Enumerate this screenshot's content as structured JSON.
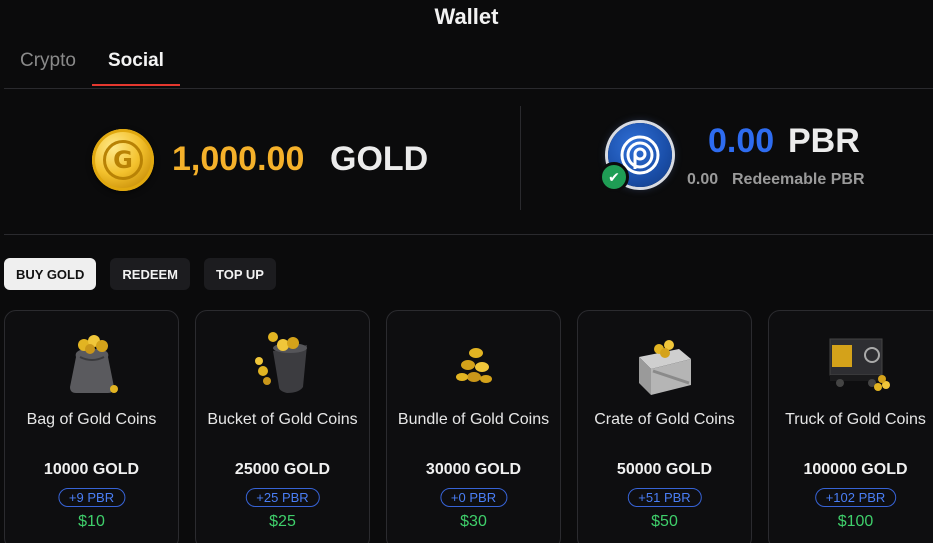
{
  "page": {
    "title": "Wallet"
  },
  "tabs": [
    {
      "label": "Crypto",
      "active": false
    },
    {
      "label": "Social",
      "active": true
    }
  ],
  "balances": {
    "gold": {
      "amount": "1,000.00",
      "unit": "GOLD",
      "icon": "gold-coin-icon"
    },
    "pbr": {
      "amount": "0.00",
      "unit": "PBR",
      "redeemable_value": "0.00",
      "redeemable_label": "Redeemable PBR",
      "icon": "pbr-coin-icon",
      "verified_icon": "check-icon"
    }
  },
  "actions": [
    {
      "label": "BUY GOLD",
      "active": true
    },
    {
      "label": "REDEEM",
      "active": false
    },
    {
      "label": "TOP UP",
      "active": false
    }
  ],
  "packages": [
    {
      "name": "Bag of Gold Coins",
      "amount": "10000 GOLD",
      "pbr_bonus": "+9 PBR",
      "price": "$10",
      "icon": "gold-bag-icon"
    },
    {
      "name": "Bucket of Gold Coins",
      "amount": "25000 GOLD",
      "pbr_bonus": "+25 PBR",
      "price": "$25",
      "icon": "gold-bucket-icon"
    },
    {
      "name": "Bundle of Gold Coins",
      "amount": "30000 GOLD",
      "pbr_bonus": "+0 PBR",
      "price": "$30",
      "icon": "gold-bundle-icon"
    },
    {
      "name": "Crate of Gold Coins",
      "amount": "50000 GOLD",
      "pbr_bonus": "+51 PBR",
      "price": "$50",
      "icon": "gold-crate-icon"
    },
    {
      "name": "Truck of Gold Coins",
      "amount": "100000 GOLD",
      "pbr_bonus": "+102 PBR",
      "price": "$100",
      "icon": "gold-truck-icon"
    }
  ],
  "colors": {
    "accent": "#e5382f",
    "gold": "#f5b12a",
    "pbr": "#2e6cf0",
    "price": "#3fcf6b"
  }
}
